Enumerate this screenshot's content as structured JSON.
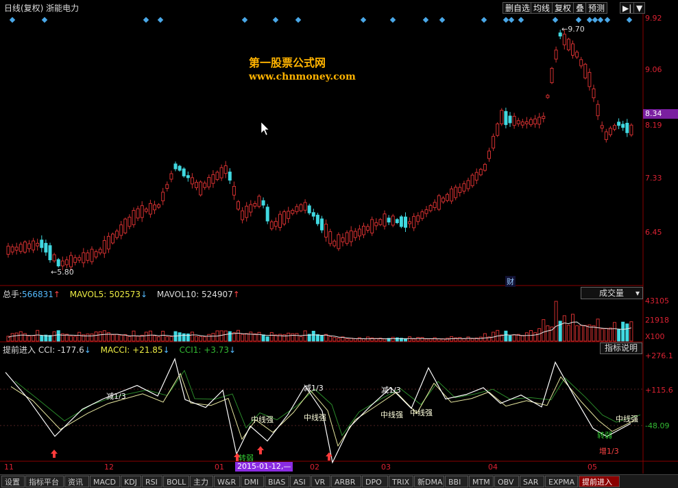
{
  "title_bar": {
    "title": "日线(复权) 浙能电力",
    "buttons": [
      "删自选",
      "均线",
      "复权",
      "叠",
      "预测",
      "▶|",
      "▼"
    ]
  },
  "watermark": {
    "line1": "第一股票公式网",
    "line2": "www.chnmoney.com"
  },
  "price_panel": {
    "axis_labels": [
      "9.92",
      "9.06",
      "8.19",
      "7.33",
      "6.45"
    ],
    "current_price": "8.34",
    "high_marker": "9.70",
    "low_marker": "5.80",
    "fin_badge": "财"
  },
  "volume_panel": {
    "header": {
      "total_label": "总手:",
      "total_value": "566831",
      "mavol5_label": "MAVOL5:",
      "mavol5_value": "502573",
      "mavol10_label": "MAVOL10:",
      "mavol10_value": "524907"
    },
    "dropdown": "成交量",
    "axis_labels": [
      "43105",
      "21918",
      "X100"
    ]
  },
  "cci_panel": {
    "header": {
      "name": "提前进入",
      "cci_label": "CCI:",
      "cci_value": "-177.6",
      "macci_label": "MACCI:",
      "macci_value": "+21.85",
      "cci1_label": "CCI1:",
      "cci1_value": "+3.73"
    },
    "button": "指标说明",
    "axis_labels": [
      "+276.1",
      "+115.6",
      "-48.09"
    ],
    "annotations": {
      "reduce": "减1/3",
      "mid_strong": "中线强",
      "turn_weak": "转弱",
      "add": "增1/3"
    }
  },
  "date_axis": {
    "labels": [
      "11",
      "12",
      "01",
      "02",
      "03",
      "04",
      "05"
    ],
    "cursor_date": "2015-01-12,—"
  },
  "tabs": [
    "设置",
    "指标平台",
    "资讯",
    "MACD",
    "KDJ",
    "RSI",
    "BOLL",
    "主力",
    "W&R",
    "DMI",
    "BIAS",
    "ASI",
    "VR",
    "ARBR",
    "DPO",
    "TRIX",
    "新DMA",
    "BBI",
    "MTM",
    "OBV",
    "SAR",
    "EXPMA",
    "提前进入"
  ],
  "active_tab": "提前进入",
  "colors": {
    "up": "#d23030",
    "down": "#40d8e0",
    "cci": "#ffffff",
    "macci": "#e8e8a0",
    "cci1": "#2a8a2a",
    "accent": "#7a1fa0"
  }
}
